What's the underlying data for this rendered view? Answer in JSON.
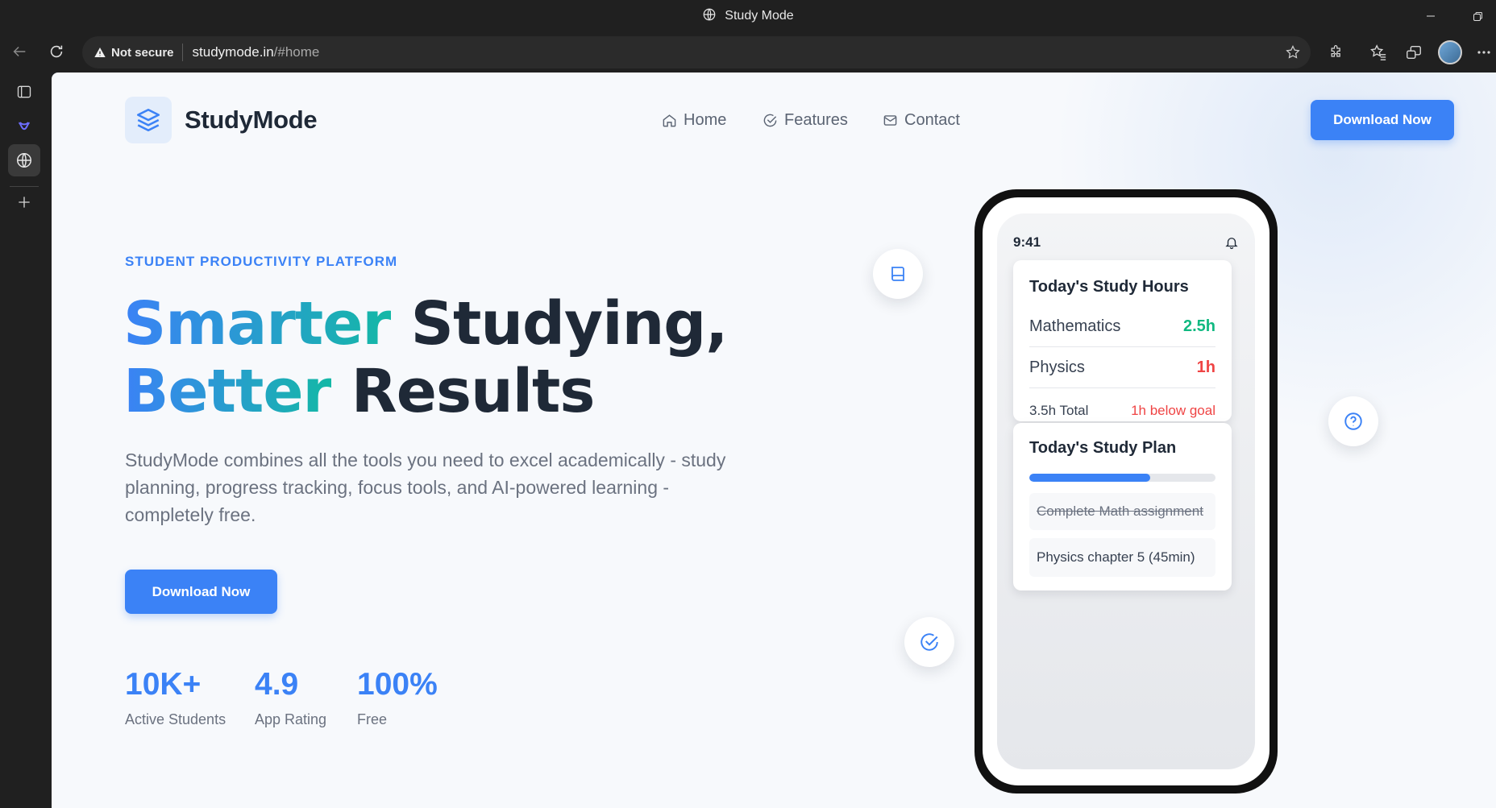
{
  "browser": {
    "window_title": "Study Mode",
    "security_label": "Not secure",
    "url_host": "studymode.in",
    "url_path": "/#home"
  },
  "site": {
    "brand": "StudyMode",
    "nav": [
      {
        "label": "Home",
        "icon": "home-icon"
      },
      {
        "label": "Features",
        "icon": "check-circle-icon"
      },
      {
        "label": "Contact",
        "icon": "mail-icon"
      }
    ],
    "header_cta": "Download Now",
    "accent_color": "#3b82f6",
    "gradient_colors": [
      "#3b82f6",
      "#14b8a6"
    ]
  },
  "hero": {
    "eyebrow": "STUDENT PRODUCTIVITY PLATFORM",
    "headline_line1_gradient": "Smarter",
    "headline_line1_rest": " Studying,",
    "headline_line2_gradient": "Better",
    "headline_line2_rest": " Results",
    "description": "StudyMode combines all the tools you need to excel academically - study planning, progress tracking, focus tools, and AI-powered learning - completely free.",
    "cta": "Download Now",
    "stats": [
      {
        "value": "10K+",
        "label": "Active Students"
      },
      {
        "value": "4.9",
        "label": "App Rating"
      },
      {
        "value": "100%",
        "label": "Free"
      }
    ]
  },
  "phone": {
    "time": "9:41",
    "hours_card": {
      "title": "Today's Study Hours",
      "subjects": [
        {
          "name": "Mathematics",
          "value": "2.5h",
          "status": "good"
        },
        {
          "name": "Physics",
          "value": "1h",
          "status": "low"
        }
      ],
      "total": "3.5h Total",
      "goal_status": "1h below goal"
    },
    "plan_card": {
      "title": "Today's Study Plan",
      "progress": 0.65,
      "tasks": [
        {
          "text": "Complete Math assignment",
          "done": true
        },
        {
          "text": "Physics chapter 5 (45min)",
          "done": false
        }
      ]
    }
  }
}
